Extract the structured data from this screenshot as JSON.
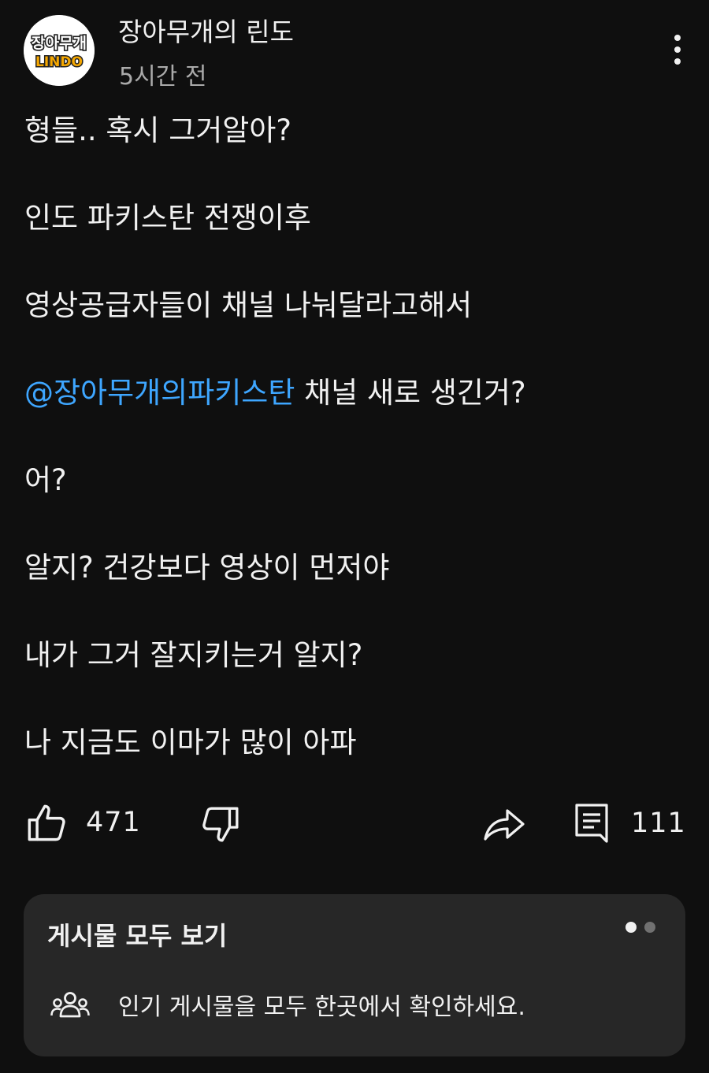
{
  "post": {
    "channel_name": "장아무개의 린도",
    "timestamp": "5시간 전",
    "avatar_text_top": "장아무개",
    "avatar_text_bottom": "LINDO",
    "lines": [
      "형들.. 혹시 그거알아?",
      "인도 파키스탄 전쟁이후",
      "영상공급자들이 채널 나눠달라고해서",
      "채널 새로 생긴거?",
      "어?",
      "알지? 건강보다 영상이 먼저야",
      "내가 그거 잘지키는거 알지?",
      "나 지금도 이마가 많이 아파"
    ],
    "mention": "@장아무개의파키스탄"
  },
  "actions": {
    "like_count": "471",
    "comment_count": "111"
  },
  "card": {
    "title": "게시물 모두 보기",
    "description": "인기 게시물을 모두 한곳에서 확인하세요.",
    "pages": 2,
    "active_page": 1
  },
  "colors": {
    "background": "#0f0f0f",
    "text": "#f1f1f1",
    "secondary_text": "#aaaaaa",
    "mention": "#3ea6ff",
    "card_background": "#272727"
  }
}
